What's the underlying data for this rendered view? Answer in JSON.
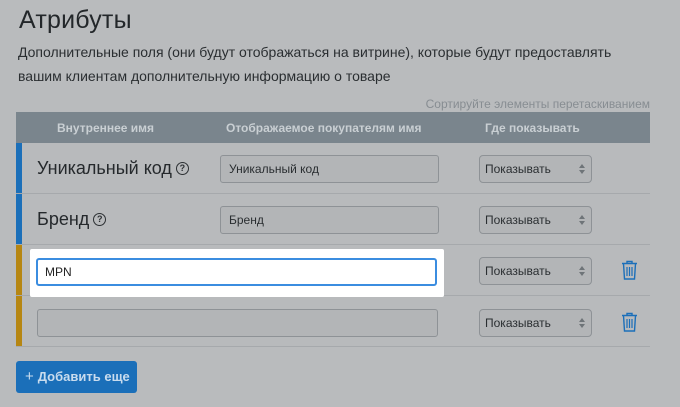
{
  "header": {
    "title": "Атрибуты",
    "description": "Дополнительные поля (они будут отображаться на витрине), которые будут предоставлять вашим клиентам дополнительную информацию о товаре"
  },
  "sort_hint": "Сортируйте элементы перетаскиванием",
  "table": {
    "columns": [
      "Внутреннее имя",
      "Отображаемое покупателям имя",
      "Где показывать"
    ],
    "rows": [
      {
        "internal_name": "Уникальный код",
        "display_name": "Уникальный код",
        "visibility": "Показывать",
        "help": "?"
      },
      {
        "internal_name": "Бренд",
        "display_name": "Бренд",
        "visibility": "Показывать",
        "help": "?"
      },
      {
        "internal_name": "MPN",
        "display_name": "",
        "visibility": "Показывать"
      },
      {
        "internal_name": "",
        "display_name": "",
        "visibility": "Показывать"
      }
    ]
  },
  "add_button": {
    "plus": "+",
    "label": "Добавить еще"
  },
  "colors": {
    "accent": "#1b6fb9",
    "custom_attr_bar": "#b68612",
    "focus": "#3b8de0"
  }
}
